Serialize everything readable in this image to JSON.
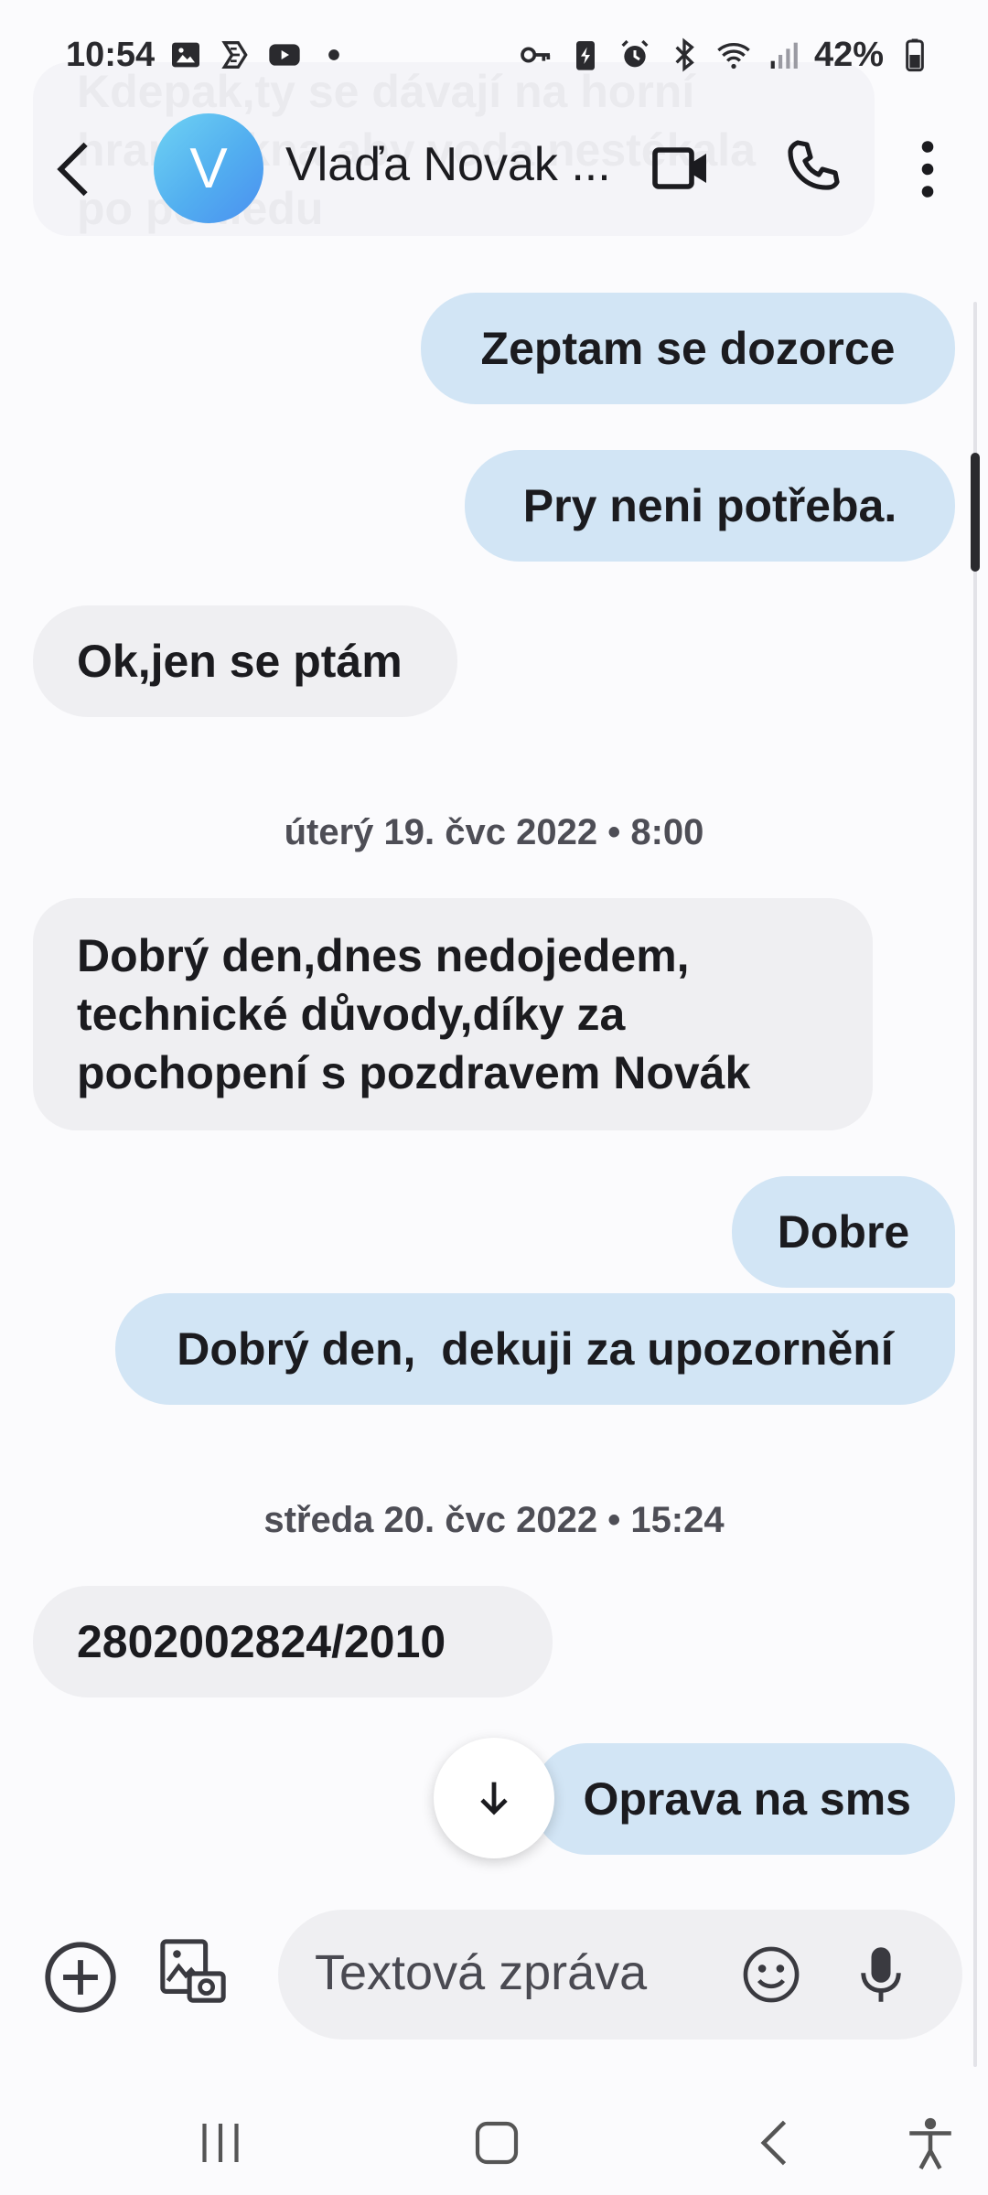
{
  "status_bar": {
    "time": "10:54",
    "battery": "42%",
    "left_icons": [
      "gallery-icon",
      "app-icon",
      "youtube-icon",
      "dot-icon"
    ],
    "right_icons": [
      "vpn-key-icon",
      "battery-saver-icon",
      "alarm-icon",
      "bluetooth-icon",
      "wifi-icon",
      "signal-icon"
    ]
  },
  "ghost_message": {
    "lines": [
      "Kdepak,ty se dávají na horní",
      "hranu okna aby voda nestékala",
      "po pohledu"
    ]
  },
  "header": {
    "avatar_letter": "V",
    "contact_name": "Vlaďa Novak ...",
    "avatar_color": "#52aef0"
  },
  "messages": [
    {
      "direction": "out",
      "text": "Zeptam se dozorce"
    },
    {
      "direction": "out",
      "text": "Pry neni potřeba."
    },
    {
      "direction": "in",
      "text": "Ok,jen se ptám"
    },
    {
      "type": "date",
      "text": "úterý 19. čvc 2022 • 8:00"
    },
    {
      "direction": "in",
      "lines": [
        "Dobrý den,dnes nedojedem,",
        "technické důvody,díky za",
        "pochopení s pozdravem Novák"
      ]
    },
    {
      "direction": "out",
      "text": "Dobre"
    },
    {
      "direction": "out",
      "text": "Dobrý den,  dekuji za upozornění"
    },
    {
      "type": "date",
      "text": "středa 20. čvc 2022 • 15:24"
    },
    {
      "direction": "in",
      "text": "2802002824/2010"
    },
    {
      "direction": "out",
      "text": "Oprava na sms"
    }
  ],
  "composer": {
    "placeholder": "Textová zpráva"
  },
  "colors": {
    "outgoing_bubble": "#d2e5f5",
    "incoming_bubble": "#efeff2",
    "background": "#fbfbfd"
  }
}
